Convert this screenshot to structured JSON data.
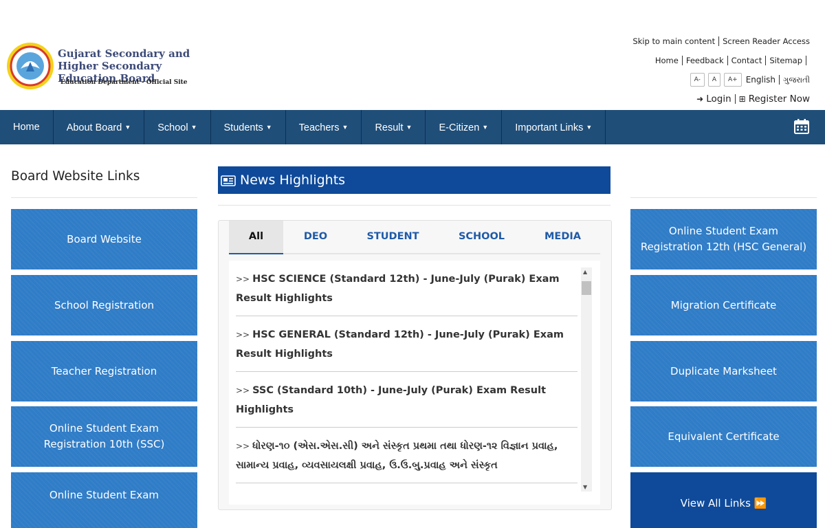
{
  "brand": {
    "title": "Gujarat Secondary and Higher Secondary Education Board",
    "subtitle": "Education Department - Official Site"
  },
  "top_links": {
    "skip": "Skip to main content",
    "screen_reader": "Screen Reader Access",
    "home": "Home",
    "feedback": "Feedback",
    "contact": "Contact",
    "sitemap": "Sitemap",
    "font_small": "A-",
    "font_normal": "A",
    "font_large": "A+",
    "lang_english": "English",
    "lang_gujarati": "ગુજરાતી",
    "login": "Login",
    "register": "Register Now"
  },
  "nav": {
    "items": [
      {
        "label": "Home",
        "caret": ""
      },
      {
        "label": "About Board",
        "caret": "▼"
      },
      {
        "label": "School",
        "caret": "▼"
      },
      {
        "label": "Students",
        "caret": "▼"
      },
      {
        "label": "Teachers",
        "caret": "▼"
      },
      {
        "label": "Result",
        "caret": "▼"
      },
      {
        "label": "E-Citizen",
        "caret": "▼"
      },
      {
        "label": "Important Links",
        "caret": "▼"
      }
    ],
    "calendar_icon": "calendar-icon"
  },
  "left": {
    "title": "Board Website Links",
    "tiles": [
      "Board Website",
      "School Registration",
      "Teacher Registration",
      "Online Student Exam Registration 10th (SSC)",
      "Online Student Exam"
    ]
  },
  "news": {
    "title": "News Highlights",
    "tabs": [
      "All",
      "DEO",
      "STUDENT",
      "SCHOOL",
      "MEDIA"
    ],
    "active_tab": "All",
    "bullet": ">>",
    "items": [
      "HSC SCIENCE (Standard 12th) - June-July (Purak) Exam Result Highlights",
      "HSC GENERAL (Standard 12th) - June-July (Purak) Exam Result Highlights",
      "SSC (Standard 10th) - June-July (Purak) Exam Result Highlights",
      "ધોરણ-૧૦ (એસ.એસ.સી) અને સંસ્કૃત પ્રથમા તથા ધોરણ-૧૨ વિજ્ઞાન પ્રવાહ, સામાન્ય પ્રવાહ, વ્યવસાયલક્ષી પ્રવાહ, ઉ.ઉ.બુ.પ્રવાહ અને સંસ્કૃત"
    ]
  },
  "right": {
    "tiles": [
      "Online Student Exam Registration 12th (HSC General)",
      "Migration Certificate",
      "Duplicate Marksheet",
      "Equivalent Certificate"
    ],
    "view_all": "View All Links ⏩"
  },
  "colors": {
    "nav_bg": "#1f4e79",
    "tile_bg": "#2f7cc7",
    "news_bar_bg": "#0f4a9a",
    "tab_text": "#1f5aa8"
  }
}
